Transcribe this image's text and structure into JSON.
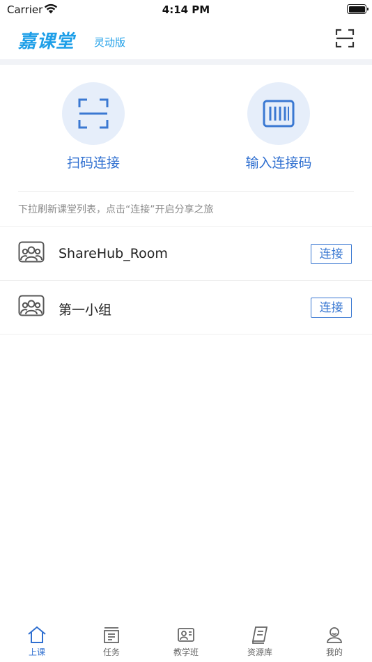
{
  "status_bar": {
    "carrier": "Carrier",
    "time": "4:14 PM"
  },
  "header": {
    "brand": "嘉课堂",
    "brand_sub": "灵动版",
    "scan_icon": "scan-icon",
    "brand_color": "#1e9fe8"
  },
  "actions": [
    {
      "label": "扫码连接",
      "icon": "scan-icon"
    },
    {
      "label": "输入连接码",
      "icon": "barcode-icon"
    }
  ],
  "hint": "下拉刷新课堂列表，点击“连接”开启分享之旅",
  "rooms": [
    {
      "name": "ShareHub_Room",
      "button": "连接",
      "icon": "group-icon"
    },
    {
      "name": "第一小组",
      "button": "连接",
      "icon": "group-icon"
    }
  ],
  "tabs": [
    {
      "label": "上课",
      "icon": "home-icon",
      "active": true
    },
    {
      "label": "任务",
      "icon": "task-icon",
      "active": false
    },
    {
      "label": "教学班",
      "icon": "class-icon",
      "active": false
    },
    {
      "label": "资源库",
      "icon": "book-icon",
      "active": false
    },
    {
      "label": "我的",
      "icon": "user-icon",
      "active": false
    }
  ],
  "colors": {
    "accent": "#2f6fd0",
    "action_bg": "#e6eefa",
    "divider": "#f1f3f7"
  }
}
